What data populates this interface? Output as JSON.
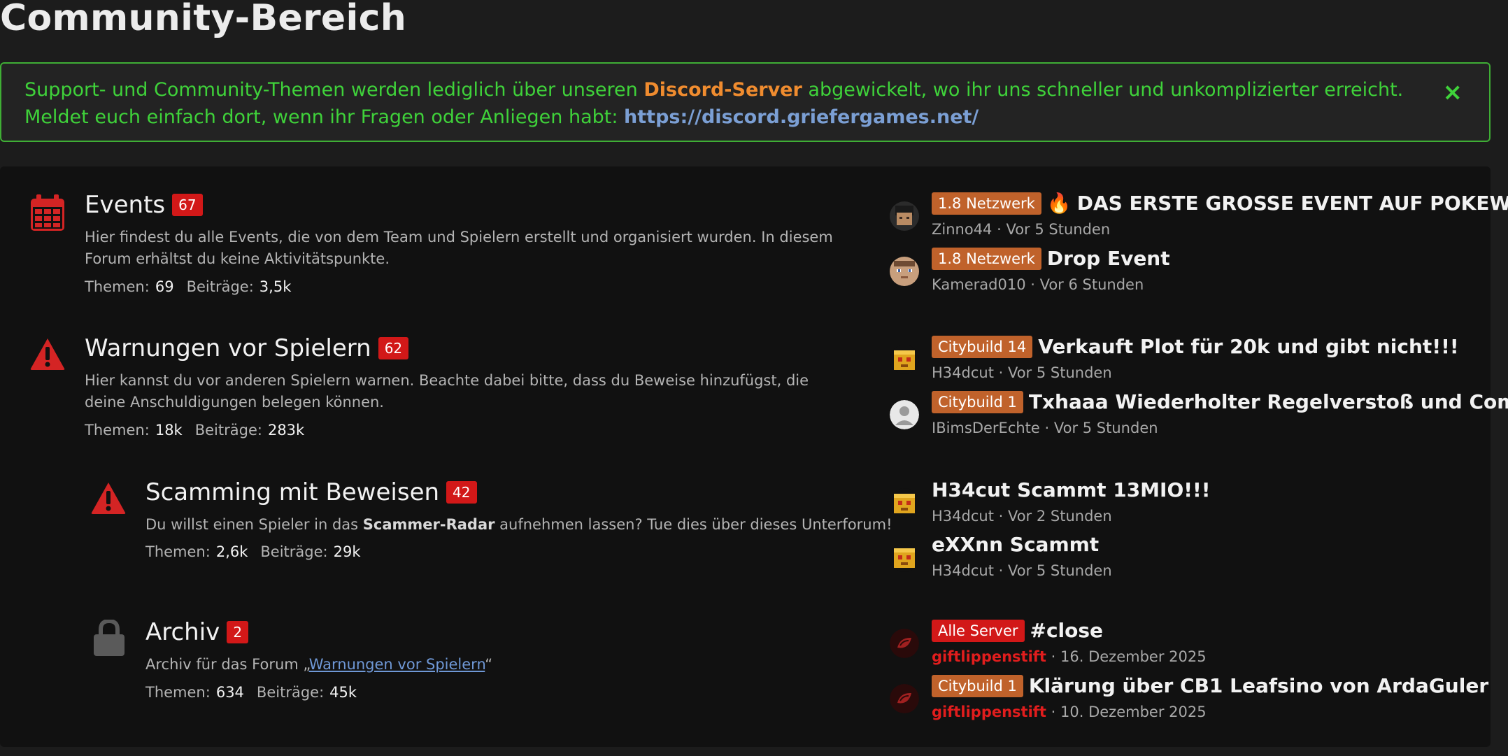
{
  "page": {
    "title": "Community-Bereich"
  },
  "notice": {
    "line1_part1": "Support- und Community-Themen werden lediglich über unseren ",
    "line1_highlight": "Discord-Server",
    "line1_part2": " abgewickelt, wo ihr uns schneller und unkomplizierter erreicht.",
    "line2_text": "Meldet euch einfach dort, wenn ihr Fragen oder Anliegen habt: ",
    "line2_link": "https://discord.griefergames.net/",
    "close_icon": "×"
  },
  "stats_labels": {
    "threads": "Themen:",
    "posts": "Beiträge:"
  },
  "nodes": [
    {
      "title": "Events",
      "badge": "67",
      "description": "Hier findest du alle Events, die von dem Team und Spielern erstellt und organisiert wurden. In diesem Forum erhältst du keine Aktivitätspunkte.",
      "threads": "69",
      "posts": "3,5k",
      "icon": "calendar-icon"
    },
    {
      "title": "Warnungen vor Spielern",
      "badge": "62",
      "description": "Hier kannst du vor anderen Spielern warnen. Beachte dabei bitte, dass du Beweise hinzufügst, die deine Anschuldigungen belegen können.",
      "threads": "18k",
      "posts": "283k",
      "icon": "warning-icon"
    },
    {
      "title": "Scamming mit Beweisen",
      "badge": "42",
      "description_before": "Du willst einen Spieler in das ",
      "description_bold": "Scammer-Radar",
      "description_after": " aufnehmen lassen? Tue dies über dieses Unterforum!",
      "threads": "2,6k",
      "posts": "29k",
      "icon": "warning-icon"
    },
    {
      "title": "Archiv",
      "badge": "2",
      "description_before": "Archiv für das Forum „",
      "description_link": "Warnungen vor Spielern",
      "description_after": "“",
      "threads": "634",
      "posts": "45k",
      "icon": "lock-icon"
    }
  ],
  "latest_posts": [
    {
      "prefix": "1.8 Netzwerk",
      "prefix_color": "#c0622b",
      "emoji": "🔥",
      "title": "DAS ERSTE GROSSE EVENT AUF POKEWORL...",
      "user": "Zinno44",
      "time": "Vor 5 Stunden"
    },
    {
      "prefix": "1.8 Netzwerk",
      "prefix_color": "#c0622b",
      "title": "Drop Event",
      "user": "Kamerad010",
      "time": "Vor 6 Stunden"
    },
    {
      "prefix": "Citybuild 14",
      "prefix_color": "#c0622b",
      "title": "Verkauft Plot für 20k und gibt nicht!!!",
      "user": "H34dcut",
      "time": "Vor 5 Stunden"
    },
    {
      "prefix": "Citybuild 1",
      "prefix_color": "#c0622b",
      "title": "Txhaaa Wiederholter Regelverstoß und Commu...",
      "user": "IBimsDerEchte",
      "time": "Vor 5 Stunden"
    },
    {
      "title": "H34cut Scammt 13MIO!!!",
      "user": "H34dcut",
      "time": "Vor 2 Stunden"
    },
    {
      "title": "eXXnn Scammt",
      "user": "H34dcut",
      "time": "Vor 5 Stunden"
    },
    {
      "prefix": "Alle Server",
      "prefix_color": "#d21818",
      "title": "#close",
      "user": "giftlippenstift",
      "time": "16. Dezember 2025",
      "user_color": "#e11d1d"
    },
    {
      "prefix": "Citybuild 1",
      "prefix_color": "#c0622b",
      "title": "Klärung über CB1 Leafsino von ArdaGuler",
      "user": "giftlippenstift",
      "time": "10. Dezember 2025",
      "user_color": "#e11d1d"
    }
  ],
  "meta_separator": " · ",
  "colors": {
    "accent_green": "#3fd23a",
    "accent_orange": "#f08c2f",
    "badge_red": "#d21818",
    "link_blue": "#7b9fd4"
  }
}
